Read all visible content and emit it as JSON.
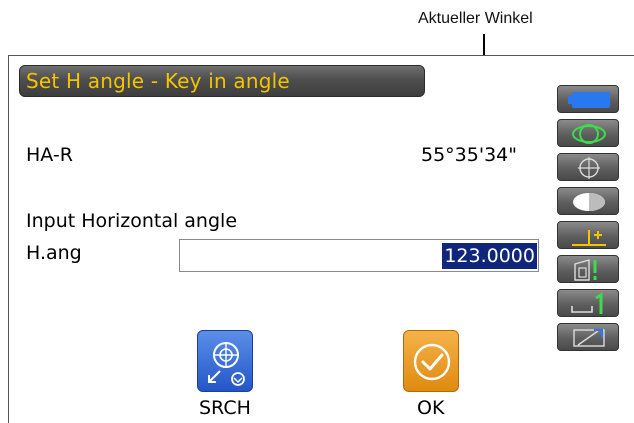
{
  "callout": {
    "label": "Aktueller Winkel"
  },
  "title": "Set H angle - Key in angle",
  "angle": {
    "label": "HA-R",
    "value": "55°35'34\""
  },
  "prompt": "Input Horizontal angle",
  "input": {
    "label": "H.ang",
    "value": "123.0000"
  },
  "softkeys": {
    "srch": "SRCH",
    "ok": "OK"
  },
  "status": {
    "tilt_value": "0",
    "accent": "#f5c400",
    "icon_green": "#3ddc4a",
    "icon_blue": "#2a78f0"
  }
}
